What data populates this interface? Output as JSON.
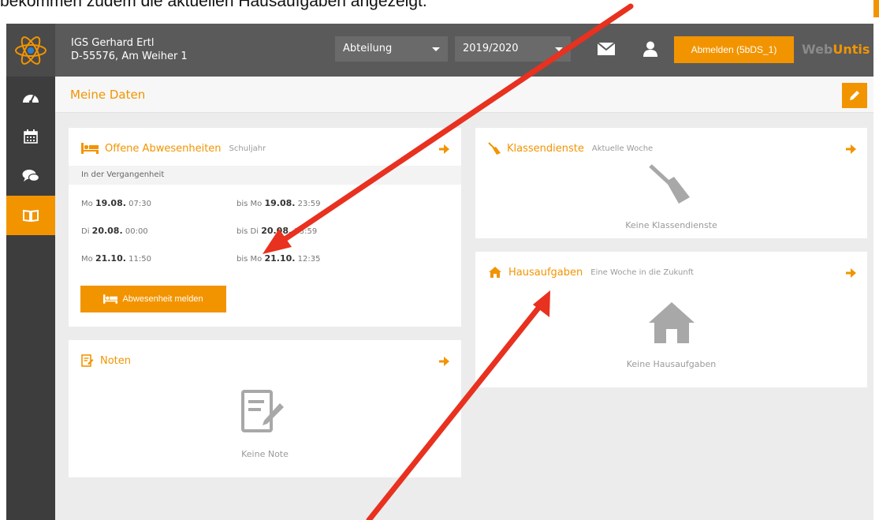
{
  "caption": "bekommen zudem die aktuellen Hausaufgaben angezeigt.",
  "colors": {
    "accent": "#f29400",
    "topbar": "#5a5a5a",
    "sidebar": "#3d3d3d",
    "annotation_arrow": "#e8311f"
  },
  "topbar": {
    "school_name": "IGS Gerhard Ertl",
    "school_address": "D-55576, Am Weiher 1",
    "department_select": "Abteilung",
    "year_select": "2019/2020",
    "logout_label": "Abmelden (5bDS_1)",
    "brand_web": "Web",
    "brand_untis": "Untis"
  },
  "sidebar": {
    "items": [
      {
        "icon": "dashboard-icon"
      },
      {
        "icon": "calendar-icon"
      },
      {
        "icon": "messages-icon"
      },
      {
        "icon": "book-icon",
        "active": true
      }
    ]
  },
  "page": {
    "title": "Meine Daten"
  },
  "absences": {
    "title": "Offene Abwesenheiten",
    "subtitle": "Schuljahr",
    "section": "In der Vergangenheit",
    "rows": [
      {
        "from_day": "Mo",
        "from_date": "19.08.",
        "from_time": "07:30",
        "to_prefix": "bis Mo",
        "to_date": "19.08.",
        "to_time": "23:59"
      },
      {
        "from_day": "Di",
        "from_date": "20.08.",
        "from_time": "00:00",
        "to_prefix": "bis Di",
        "to_date": "20.08.",
        "to_time": "23:59"
      },
      {
        "from_day": "Mo",
        "from_date": "21.10.",
        "from_time": "11:50",
        "to_prefix": "bis Mo",
        "to_date": "21.10.",
        "to_time": "12:35"
      }
    ],
    "button": "Abwesenheit melden"
  },
  "grades": {
    "title": "Noten",
    "empty": "Keine Note"
  },
  "class_duties": {
    "title": "Klassendienste",
    "subtitle": "Aktuelle Woche",
    "empty": "Keine Klassendienste"
  },
  "homework": {
    "title": "Hausaufgaben",
    "subtitle": "Eine Woche in die Zukunft",
    "empty": "Keine Hausaufgaben"
  }
}
